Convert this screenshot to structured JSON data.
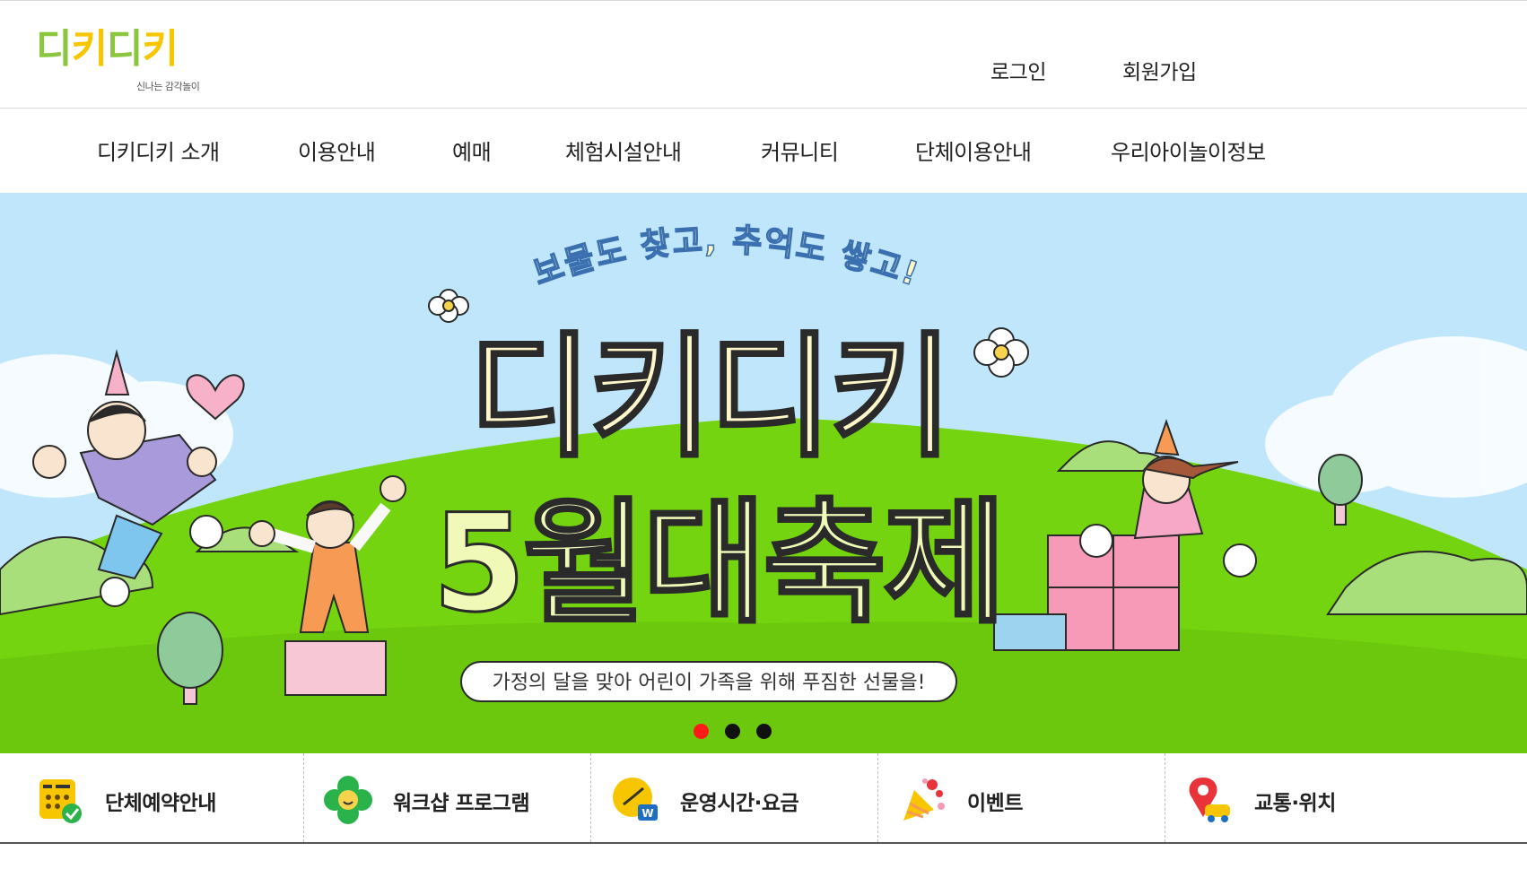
{
  "header": {
    "logo_text": [
      "디",
      "키",
      "디",
      "키"
    ],
    "logo_tagline": "신나는 감각놀이",
    "login": "로그인",
    "signup": "회원가입"
  },
  "nav": {
    "items": [
      {
        "label": "디키디키 소개"
      },
      {
        "label": "이용안내"
      },
      {
        "label": "예매"
      },
      {
        "label": "체험시설안내"
      },
      {
        "label": "커뮤니티"
      },
      {
        "label": "단체이용안내"
      },
      {
        "label": "우리아이놀이정보"
      }
    ]
  },
  "hero": {
    "arc_text": "보물도 찾고, 추억도 쌓고!",
    "title_line1": "디키디키",
    "title_line2": "5월대축제",
    "subtitle": "가정의 달을 맞아 어린이 가족을 위해 푸짐한 선물을!",
    "slides": 3,
    "active_slide": 1,
    "colors": {
      "sky": "#bfe6fb",
      "grass": "#74d40f",
      "active_dot": "#ff1a1a",
      "dot": "#111111"
    }
  },
  "quick_menu": {
    "items": [
      {
        "label": "단체예약안내",
        "icon": "calendar-check-icon"
      },
      {
        "label": "워크샵 프로그램",
        "icon": "flower-icon"
      },
      {
        "label": "운영시간·요금",
        "icon": "clock-won-icon"
      },
      {
        "label": "이벤트",
        "icon": "party-popper-icon"
      },
      {
        "label": "교통·위치",
        "icon": "location-car-icon"
      }
    ]
  }
}
